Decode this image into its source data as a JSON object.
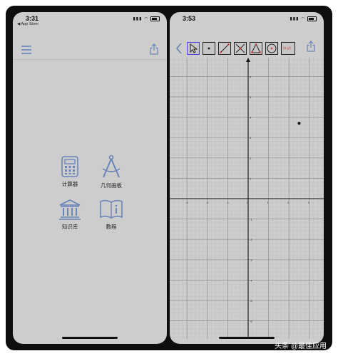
{
  "left_screen": {
    "time": "3:31",
    "back_app": "◀ App Store",
    "apps": [
      {
        "label": "计算器",
        "icon": "calculator-icon"
      },
      {
        "label": "几何画板",
        "icon": "compass-icon"
      },
      {
        "label": "知识库",
        "icon": "library-icon"
      },
      {
        "label": "教程",
        "icon": "book-info-icon"
      }
    ]
  },
  "right_screen": {
    "time": "3:53",
    "tools": [
      "back-icon",
      "pointer-tool-icon",
      "point-tool-icon",
      "segment-tool-icon",
      "intersection-tool-icon",
      "triangle-tool-icon",
      "circle-tool-icon",
      "coordinate-tool-icon"
    ],
    "coordinate_tool_label": "(x,y)",
    "x_ticks": [
      "-3",
      "-2",
      "-1",
      "0",
      "1",
      "2",
      "3"
    ],
    "y_ticks": [
      "6",
      "5",
      "4",
      "3",
      "2",
      "1",
      "-1",
      "-2",
      "-3",
      "-4",
      "-5",
      "-6"
    ],
    "point": {
      "x": 2.5,
      "y": 3.7
    }
  },
  "watermark": "头条 @最佳应用",
  "accent_color": "#6a84b8"
}
